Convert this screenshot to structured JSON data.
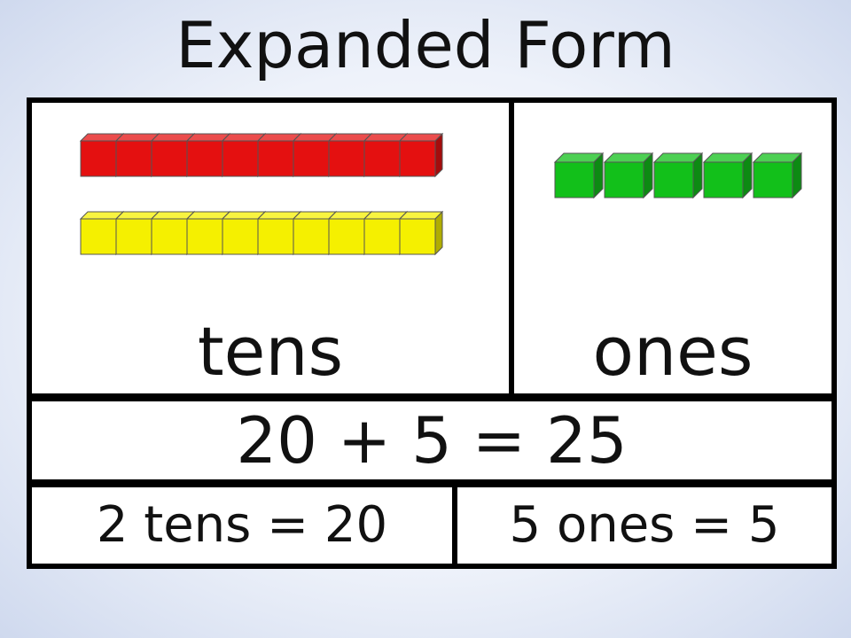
{
  "title": "Expanded Form",
  "columns": {
    "tens_label": "tens",
    "ones_label": "ones"
  },
  "equation": "20 + 5 = 25",
  "breakdown": {
    "tens": "2 tens = 20",
    "ones": "5 ones = 5"
  },
  "blocks": {
    "tens_rods": [
      {
        "color": "#e41010",
        "units": 10
      },
      {
        "color": "#f5f000",
        "units": 10
      }
    ],
    "ones_cubes": {
      "color": "#12c01a",
      "count": 5
    }
  }
}
